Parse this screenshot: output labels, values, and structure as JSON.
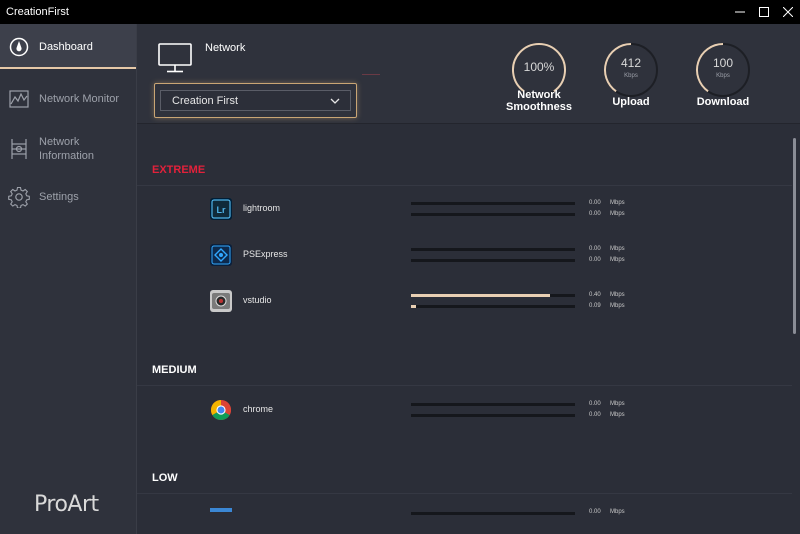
{
  "window": {
    "title": "CreationFirst"
  },
  "sidebar": {
    "items": [
      {
        "label": "Dashboard",
        "icon": "dashboard-icon"
      },
      {
        "label": "Network Monitor",
        "icon": "network-monitor-icon"
      },
      {
        "label_line1": "Network",
        "label_line2": "Information",
        "icon": "network-information-icon"
      },
      {
        "label": "Settings",
        "icon": "gear-icon"
      }
    ],
    "brand": "ProArt"
  },
  "header": {
    "network_label": "Network",
    "profile_selected": "Creation First",
    "gauges": [
      {
        "value": "100%",
        "unit": "",
        "label_line1": "Network",
        "label_line2": "Smoothness",
        "fraction": 1.0
      },
      {
        "value": "412",
        "unit": "Kbps",
        "label_line1": "Upload",
        "label_line2": "",
        "fraction": 0.5
      },
      {
        "value": "100",
        "unit": "Kbps",
        "label_line1": "Download",
        "label_line2": "",
        "fraction": 0.5
      }
    ]
  },
  "sections": [
    {
      "title": "EXTREME",
      "apps": [
        {
          "name": "lightroom",
          "up": "0.00",
          "down": "0.00",
          "up_fill": 0,
          "down_fill": 0,
          "unit": "Mbps"
        },
        {
          "name": "PSExpress",
          "up": "0.00",
          "down": "0.00",
          "up_fill": 0,
          "down_fill": 0,
          "unit": "Mbps"
        },
        {
          "name": "vstudio",
          "up": "0.40",
          "down": "0.09",
          "up_fill": 0.85,
          "down_fill": 0.03,
          "unit": "Mbps"
        }
      ]
    },
    {
      "title": "MEDIUM",
      "apps": [
        {
          "name": "chrome",
          "up": "0.00",
          "down": "0.00",
          "up_fill": 0,
          "down_fill": 0,
          "unit": "Mbps"
        }
      ]
    },
    {
      "title": "LOW",
      "apps": [
        {
          "name": "",
          "up": "0.00",
          "down": "",
          "up_fill": 0,
          "down_fill": 0,
          "unit": "Mbps"
        }
      ]
    }
  ],
  "colors": {
    "accent": "#e8cfb3",
    "extreme": "#e2213b",
    "dropdown_border": "#c9a574"
  }
}
